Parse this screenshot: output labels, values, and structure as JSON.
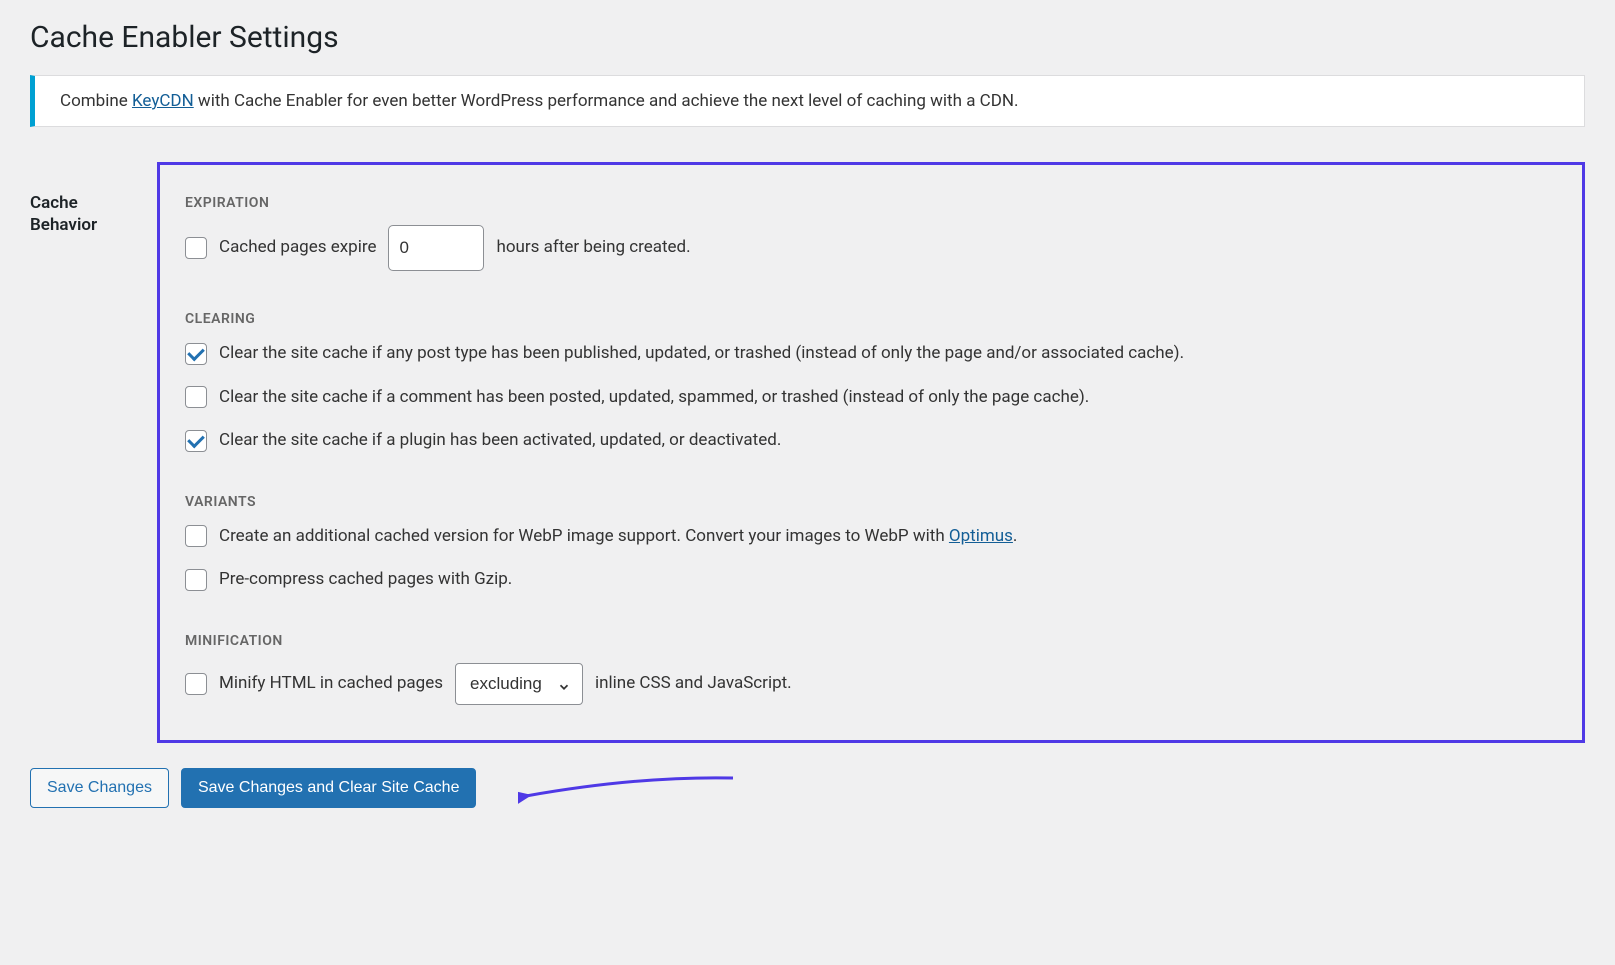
{
  "page_title": "Cache Enabler Settings",
  "notice": {
    "prefix": "Combine ",
    "link_text": "KeyCDN",
    "suffix": " with Cache Enabler for even better WordPress performance and achieve the next level of caching with a CDN."
  },
  "section_label": "Cache Behavior",
  "expiration": {
    "heading": "EXPIRATION",
    "checked": false,
    "prefix": "Cached pages expire",
    "value": "0",
    "suffix": "hours after being created."
  },
  "clearing": {
    "heading": "CLEARING",
    "items": [
      {
        "checked": true,
        "text": "Clear the site cache if any post type has been published, updated, or trashed (instead of only the page and/or associated cache)."
      },
      {
        "checked": false,
        "text": "Clear the site cache if a comment has been posted, updated, spammed, or trashed (instead of only the page cache)."
      },
      {
        "checked": true,
        "text": "Clear the site cache if a plugin has been activated, updated, or deactivated."
      }
    ]
  },
  "variants": {
    "heading": "VARIANTS",
    "items": [
      {
        "checked": false,
        "text_pre": "Create an additional cached version for WebP image support. Convert your images to WebP with ",
        "link": "Optimus",
        "text_post": "."
      },
      {
        "checked": false,
        "text": "Pre-compress cached pages with Gzip."
      }
    ]
  },
  "minification": {
    "heading": "MINIFICATION",
    "checked": false,
    "prefix": "Minify HTML in cached pages",
    "selected": "excluding",
    "suffix": "inline CSS and JavaScript."
  },
  "buttons": {
    "save": "Save Changes",
    "save_clear": "Save Changes and Clear Site Cache"
  }
}
